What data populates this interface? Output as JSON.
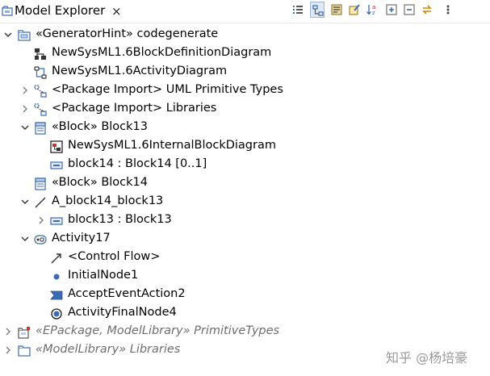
{
  "window": {
    "tab_title": "Model Explorer",
    "close_glyph": "×"
  },
  "toolbar": {
    "buttons": [
      {
        "name": "show-list-icon"
      },
      {
        "name": "link-editor-icon"
      },
      {
        "name": "filter-icon"
      },
      {
        "name": "customize-view-icon"
      },
      {
        "name": "sort-az-icon"
      },
      {
        "name": "expand-all-icon"
      },
      {
        "name": "collapse-all-icon"
      },
      {
        "name": "sync-icon"
      },
      {
        "name": "view-menu-icon"
      }
    ]
  },
  "tree": {
    "rows": [
      {
        "label": "«GeneratorHint» codegenerate",
        "twisty": "expanded",
        "icon": "package-icon",
        "level": 0,
        "selected": false,
        "muted": false
      },
      {
        "label": "NewSysML1.6BlockDefinitionDiagram",
        "twisty": "none",
        "icon": "block-definition-diagram-icon",
        "level": 1,
        "muted": false
      },
      {
        "label": "NewSysML1.6ActivityDiagram",
        "twisty": "none",
        "icon": "activity-diagram-icon",
        "level": 1,
        "muted": false
      },
      {
        "label": "<Package Import> UML Primitive Types",
        "twisty": "collapsed",
        "icon": "package-import-icon",
        "level": 1,
        "muted": false
      },
      {
        "label": "<Package Import> Libraries",
        "twisty": "collapsed",
        "icon": "package-import-icon",
        "level": 1,
        "muted": false
      },
      {
        "label": "«Block» Block13",
        "twisty": "expanded",
        "icon": "block-icon",
        "level": 1,
        "muted": false
      },
      {
        "label": "NewSysML1.6InternalBlockDiagram",
        "twisty": "none",
        "icon": "internal-block-diagram-icon",
        "level": 2,
        "muted": false
      },
      {
        "label": "block14 : Block14 [0..1]",
        "twisty": "none",
        "icon": "property-icon",
        "level": 2,
        "muted": false
      },
      {
        "label": "«Block» Block14",
        "twisty": "none",
        "icon": "block-icon",
        "level": 1,
        "muted": false
      },
      {
        "label": "A_block14_block13",
        "twisty": "expanded",
        "icon": "association-icon",
        "level": 1,
        "muted": false
      },
      {
        "label": "block13 : Block13",
        "twisty": "collapsed",
        "icon": "property-icon",
        "level": 2,
        "muted": false
      },
      {
        "label": "Activity17",
        "twisty": "expanded",
        "icon": "activity-icon",
        "level": 1,
        "muted": false
      },
      {
        "label": "<Control Flow>",
        "twisty": "none",
        "icon": "control-flow-icon",
        "level": 2,
        "muted": false
      },
      {
        "label": "InitialNode1",
        "twisty": "none",
        "icon": "initial-node-icon",
        "level": 2,
        "muted": false
      },
      {
        "label": "AcceptEventAction2",
        "twisty": "none",
        "icon": "accept-event-icon",
        "level": 2,
        "muted": false
      },
      {
        "label": "ActivityFinalNode4",
        "twisty": "none",
        "icon": "final-node-icon",
        "level": 2,
        "muted": false
      },
      {
        "label": "«EPackage, ModelLibrary» PrimitiveTypes",
        "twisty": "collapsed",
        "icon": "epackage-icon",
        "level": 0,
        "muted": true
      },
      {
        "label": "«ModelLibrary» Libraries",
        "twisty": "collapsed",
        "icon": "folder-package-icon",
        "level": 0,
        "muted": true
      }
    ]
  },
  "watermark": {
    "text": "知乎 @杨培豪"
  },
  "colors": {
    "tab_background": "#ffffff",
    "icon_blue": "#3b6bb5",
    "icon_dark": "#1a1a1a",
    "muted_text": "#6e6e6e"
  }
}
